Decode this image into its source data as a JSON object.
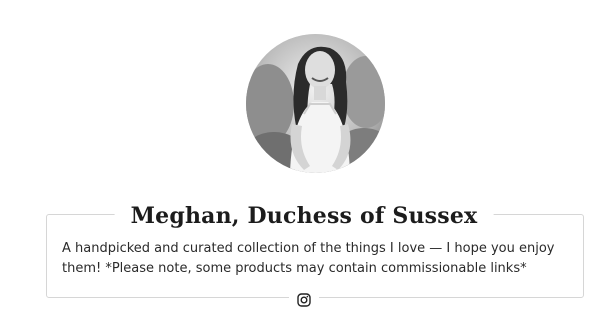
{
  "profile": {
    "avatar_alt": "avatar",
    "name": "Meghan, Duchess of Sussex",
    "bio": "A handpicked and curated collection of the things I love — I hope you enjoy them! *Please note, some products may contain commissionable links*"
  },
  "social": {
    "icons": [
      "instagram-icon"
    ]
  },
  "colors": {
    "border": "#d6d6d6",
    "text": "#1c1c1c",
    "background": "#ffffff"
  }
}
